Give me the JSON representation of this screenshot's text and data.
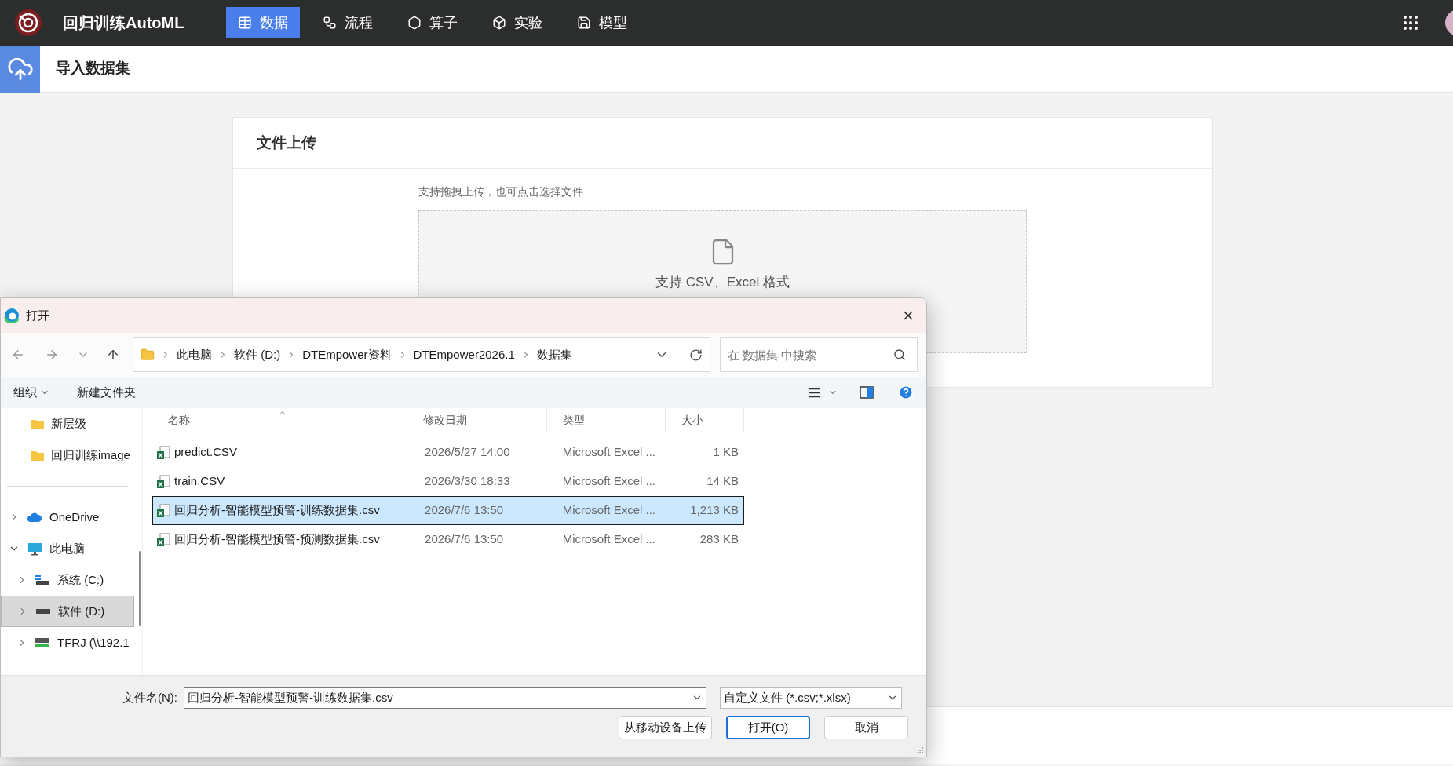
{
  "app": {
    "title": "回归训练AutoML",
    "nav": [
      {
        "label": "数据",
        "kind": "data",
        "selected": true
      },
      {
        "label": "流程",
        "kind": "flow",
        "selected": false
      },
      {
        "label": "算子",
        "kind": "operator",
        "selected": false
      },
      {
        "label": "实验",
        "kind": "experiment",
        "selected": false
      },
      {
        "label": "模型",
        "kind": "model",
        "selected": false
      }
    ]
  },
  "page_header": {
    "title": "导入数据集"
  },
  "upload_card": {
    "title": "文件上传",
    "hint": "支持拖拽上传，也可点击选择文件",
    "dropzone_text": "支持 CSV、Excel 格式"
  },
  "dialog": {
    "title": "打开",
    "address": {
      "segments": [
        "此电脑",
        "软件 (D:)",
        "DTEmpower资料",
        "DTEmpower2026.1",
        "数据集"
      ]
    },
    "search": {
      "placeholder": "在 数据集 中搜索"
    },
    "toolbar": {
      "organize": "组织",
      "new_folder": "新建文件夹"
    },
    "nav_pane": {
      "pinned": [
        {
          "label": "新层级",
          "kind": "folder",
          "selected": false
        },
        {
          "label": "回归训练image",
          "kind": "folder",
          "selected": false
        }
      ],
      "tree": [
        {
          "label": "OneDrive",
          "kind": "cloud",
          "expanded": false,
          "selected": false
        },
        {
          "label": "此电脑",
          "kind": "computer",
          "expanded": true,
          "selected": false,
          "children": [
            {
              "label": "系统 (C:)",
              "kind": "system-drive",
              "expanded": false,
              "selected": false
            },
            {
              "label": "软件 (D:)",
              "kind": "drive",
              "expanded": false,
              "selected": true
            },
            {
              "label": "TFRJ (\\\\192.1",
              "kind": "net-drive",
              "expanded": false,
              "selected": false
            }
          ]
        }
      ]
    },
    "columns": [
      "名称",
      "修改日期",
      "类型",
      "大小"
    ],
    "rows": [
      {
        "name": "predict.CSV",
        "modified": "2026/5/27 14:00",
        "type": "Microsoft Excel ...",
        "size": "1 KB",
        "selected": false
      },
      {
        "name": "train.CSV",
        "modified": "2026/3/30 18:33",
        "type": "Microsoft Excel ...",
        "size": "14 KB",
        "selected": false
      },
      {
        "name": "回归分析-智能模型预警-训练数据集.csv",
        "modified": "2026/7/6 13:50",
        "type": "Microsoft Excel ...",
        "size": "1,213 KB",
        "selected": true
      },
      {
        "name": "回归分析-智能模型预警-预测数据集.csv",
        "modified": "2026/7/6 13:50",
        "type": "Microsoft Excel ...",
        "size": "283 KB",
        "selected": false
      }
    ],
    "filename": {
      "label": "文件名(N):",
      "value": "回归分析-智能模型预警-训练数据集.csv"
    },
    "file_type": {
      "value": "自定义文件 (*.csv;*.xlsx)"
    },
    "buttons": [
      {
        "label": "从移动设备上传",
        "default": false
      },
      {
        "label": "打开(O)",
        "default": true
      },
      {
        "label": "取消",
        "default": false
      }
    ]
  }
}
